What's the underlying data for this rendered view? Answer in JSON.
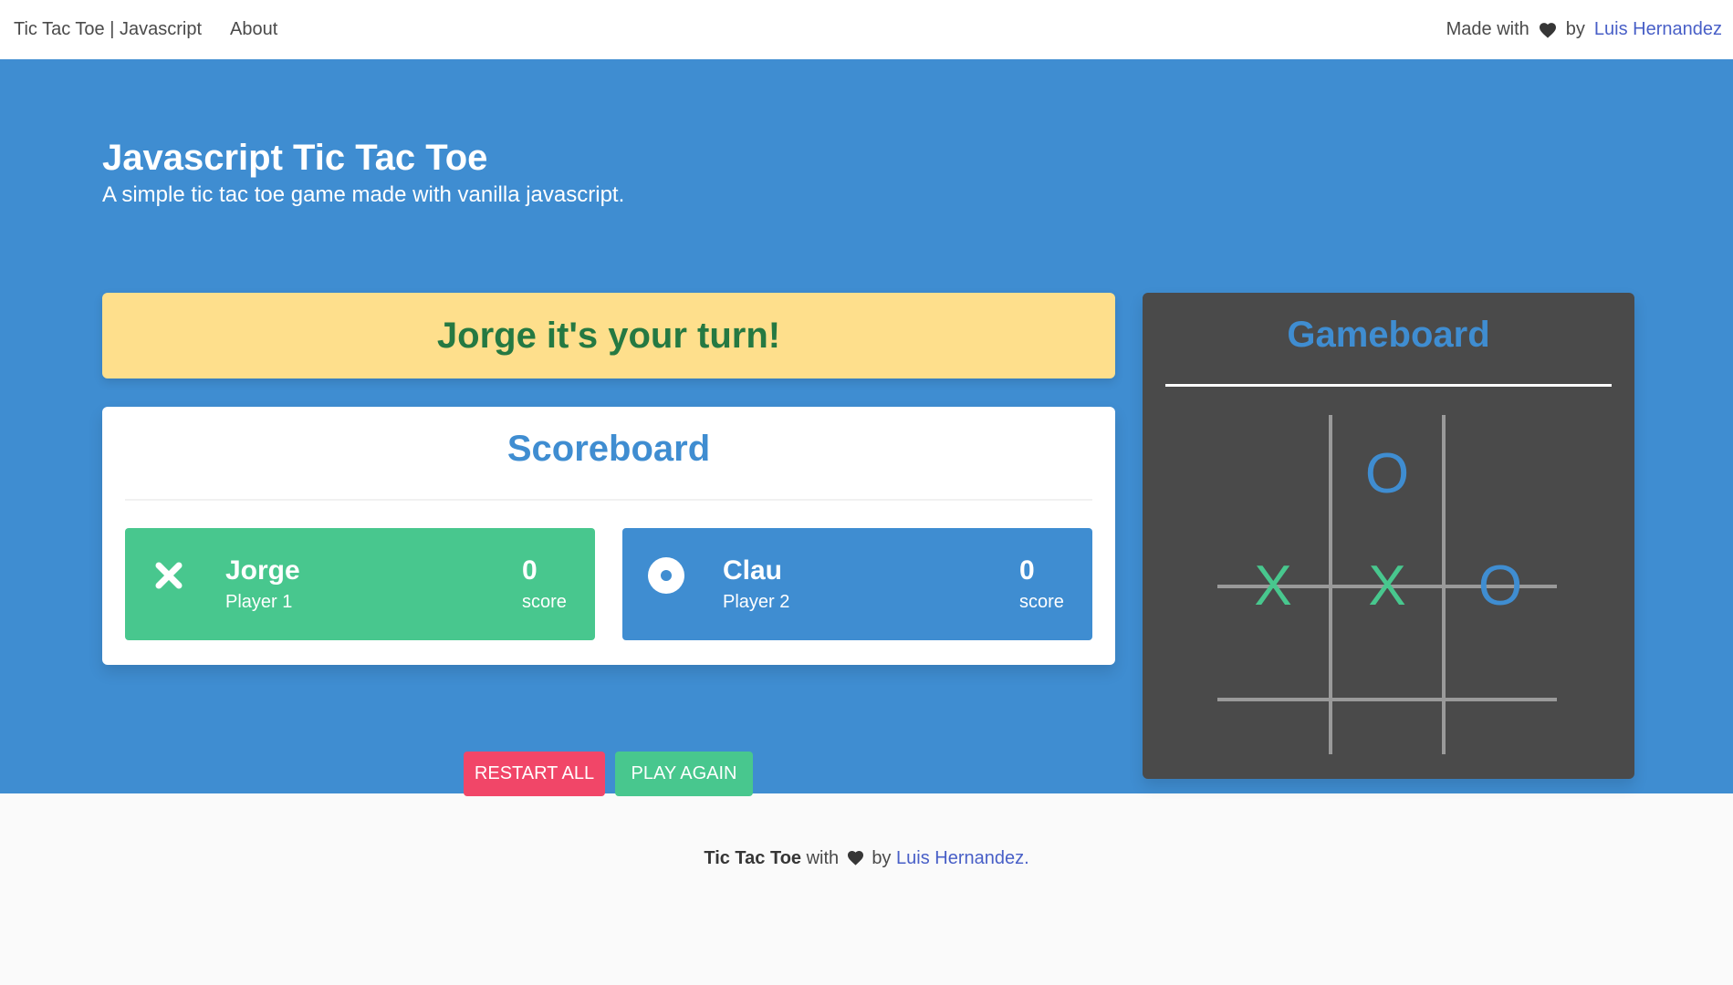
{
  "nav": {
    "brand": "Tic Tac Toe | Javascript",
    "about": "About",
    "made_with": "Made with",
    "by": "by",
    "author": "Luis Hernandez"
  },
  "hero": {
    "title": "Javascript Tic Tac Toe",
    "subtitle": "A simple tic tac toe game made with vanilla javascript."
  },
  "turn_message": "Jorge it's your turn!",
  "scoreboard": {
    "title": "Scoreboard",
    "players": [
      {
        "name": "Jorge",
        "role": "Player 1",
        "score": "0",
        "score_label": "score",
        "icon": "x-icon"
      },
      {
        "name": "Clau",
        "role": "Player 2",
        "score": "0",
        "score_label": "score",
        "icon": "circle-dot-icon"
      }
    ]
  },
  "buttons": {
    "restart": "RESTART ALL",
    "play_again": "PLAY AGAIN"
  },
  "gameboard": {
    "title": "Gameboard",
    "cells": [
      "",
      "O",
      "",
      "X",
      "X",
      "O",
      "",
      "",
      ""
    ]
  },
  "footer": {
    "app_name": "Tic Tac Toe",
    "with": "with",
    "by": "by",
    "author": "Luis Hernandez",
    "period": "."
  },
  "colors": {
    "primary": "#3f8dd1",
    "success": "#48c78e",
    "danger": "#f14668",
    "warning": "#fedf8c",
    "dark": "#4a4a4a"
  }
}
